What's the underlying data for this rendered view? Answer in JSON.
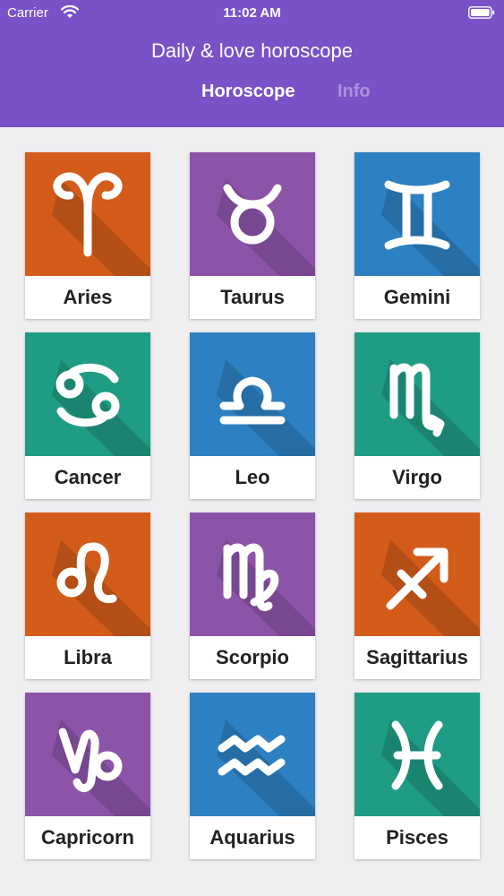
{
  "status_bar": {
    "carrier": "Carrier",
    "time": "11:02 AM"
  },
  "header": {
    "title": "Daily & love horoscope",
    "tabs": [
      {
        "label": "Horoscope",
        "active": true
      },
      {
        "label": "Info",
        "active": false
      }
    ]
  },
  "signs": [
    {
      "name": "Aries",
      "color": "#d35c1a",
      "icon": "aries-icon"
    },
    {
      "name": "Taurus",
      "color": "#8c54a8",
      "icon": "taurus-icon"
    },
    {
      "name": "Gemini",
      "color": "#2d80c2",
      "icon": "gemini-icon"
    },
    {
      "name": "Cancer",
      "color": "#1f9c84",
      "icon": "cancer-icon"
    },
    {
      "name": "Leo",
      "color": "#2d80c2",
      "icon": "libra-symbol-icon"
    },
    {
      "name": "Virgo",
      "color": "#1f9c84",
      "icon": "scorpio-symbol-icon"
    },
    {
      "name": "Libra",
      "color": "#d35c1a",
      "icon": "leo-symbol-icon"
    },
    {
      "name": "Scorpio",
      "color": "#8c54a8",
      "icon": "virgo-symbol-icon"
    },
    {
      "name": "Sagittarius",
      "color": "#d35c1a",
      "icon": "sagittarius-icon"
    },
    {
      "name": "Capricorn",
      "color": "#8c54a8",
      "icon": "capricorn-icon"
    },
    {
      "name": "Aquarius",
      "color": "#2d80c2",
      "icon": "aquarius-icon"
    },
    {
      "name": "Pisces",
      "color": "#1f9c84",
      "icon": "pisces-icon"
    }
  ]
}
